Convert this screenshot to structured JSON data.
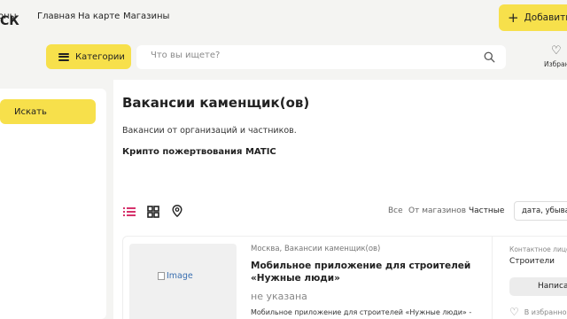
{
  "topnav": {
    "partial_left": "оны",
    "links": [
      "Главная",
      "На карте",
      "Магазины"
    ],
    "add_label": "Добавить"
  },
  "header": {
    "logo_partial": "СК",
    "categories_label": "Категории",
    "search_placeholder": "Что вы ищете?",
    "favorites_partial": "Избран"
  },
  "sidebar": {
    "search_button": "Искать"
  },
  "main": {
    "title": "Вакансии каменщик(ов)",
    "description": "Вакансии от организаций и частников.",
    "promo": "Крипто пожертвования MATIC"
  },
  "toolbar": {
    "filters": [
      "Все",
      "От магазинов",
      "Частные"
    ],
    "active_filter": "Частные",
    "sort_value": "дата, убыван"
  },
  "listing": {
    "image_alt": "Image",
    "meta": "Москва, Вакансии каменщик(ов)",
    "title": "Мобильное приложение для строителей «Нужные люди»",
    "price": "не указана",
    "description": "Мобильное приложение для строителей «Нужные люди» -",
    "contact_label": "Контактное лицо",
    "contact_name": "Строители",
    "write_label": "Написать",
    "favorite_label": "В избранное"
  },
  "colors": {
    "accent_yellow": "#f7e04b",
    "list_icon_active": "#d6336c",
    "background": "#f4f4f2"
  }
}
